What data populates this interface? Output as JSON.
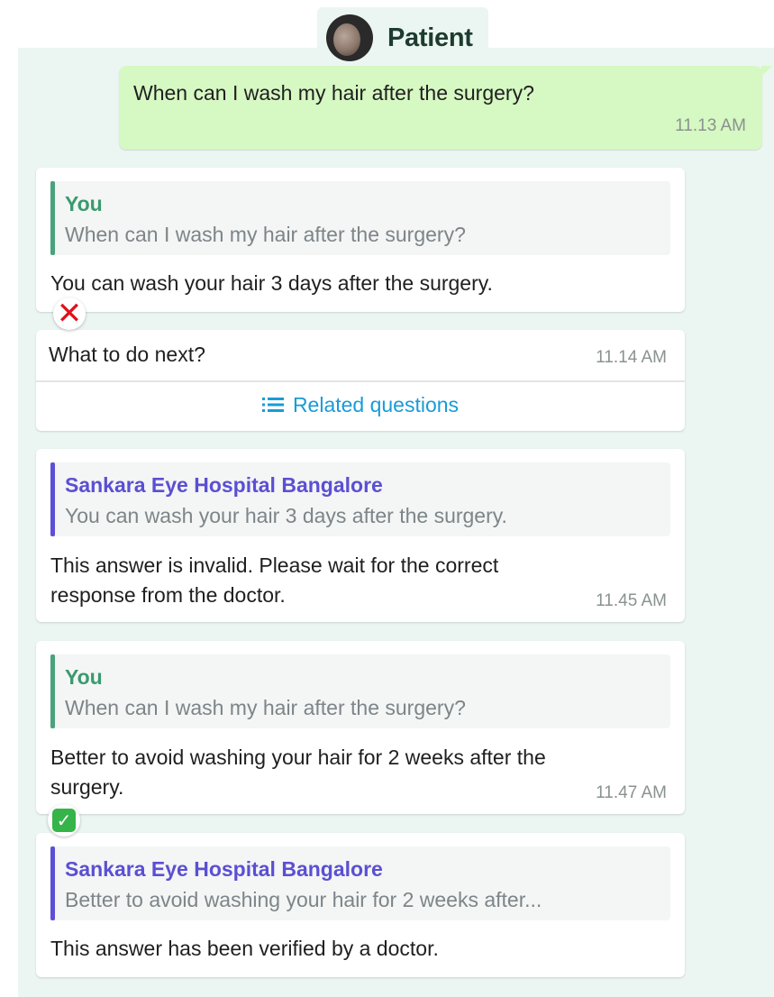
{
  "header": {
    "title": "Patient",
    "avatar_icon": "patient-avatar"
  },
  "outgoing": {
    "text": "When can I wash my hair after the surgery?",
    "time": "11.13 AM"
  },
  "cards": [
    {
      "quote_name": "You",
      "quote_text": "When can I wash my hair after the surgery?",
      "message": "You can wash your hair 3 days after the surgery.",
      "status_icon": "cross-mark-icon"
    },
    {
      "quote_name": "Sankara Eye Hospital Bangalore",
      "quote_text": "You can wash your hair 3 days after the surgery.",
      "message_line1": "This answer is invalid. Please wait for the correct",
      "message_line2": "response from the doctor.",
      "time": "11.45 AM"
    },
    {
      "quote_name": "You",
      "quote_text": "When can I wash my hair after the surgery?",
      "message_line1": "Better to avoid washing your hair for 2 weeks after the",
      "message_line2": "surgery.",
      "time": "11.47 AM",
      "status_icon": "check-mark-icon"
    },
    {
      "quote_name": "Sankara Eye Hospital Bangalore",
      "quote_text": "Better to avoid washing your hair for 2 weeks after...",
      "message": "This answer has been verified by a doctor."
    }
  ],
  "next": {
    "prompt": "What to do next?",
    "time": "11.14 AM",
    "related_label": "Related questions",
    "related_icon": "list-icon"
  },
  "colors": {
    "chat_bg": "#ebf6f3",
    "outgoing_bubble": "#d6f8c2",
    "link": "#1a9bd7",
    "you_accent": "#4aa27e",
    "hospital_accent": "#5e4fd7"
  }
}
